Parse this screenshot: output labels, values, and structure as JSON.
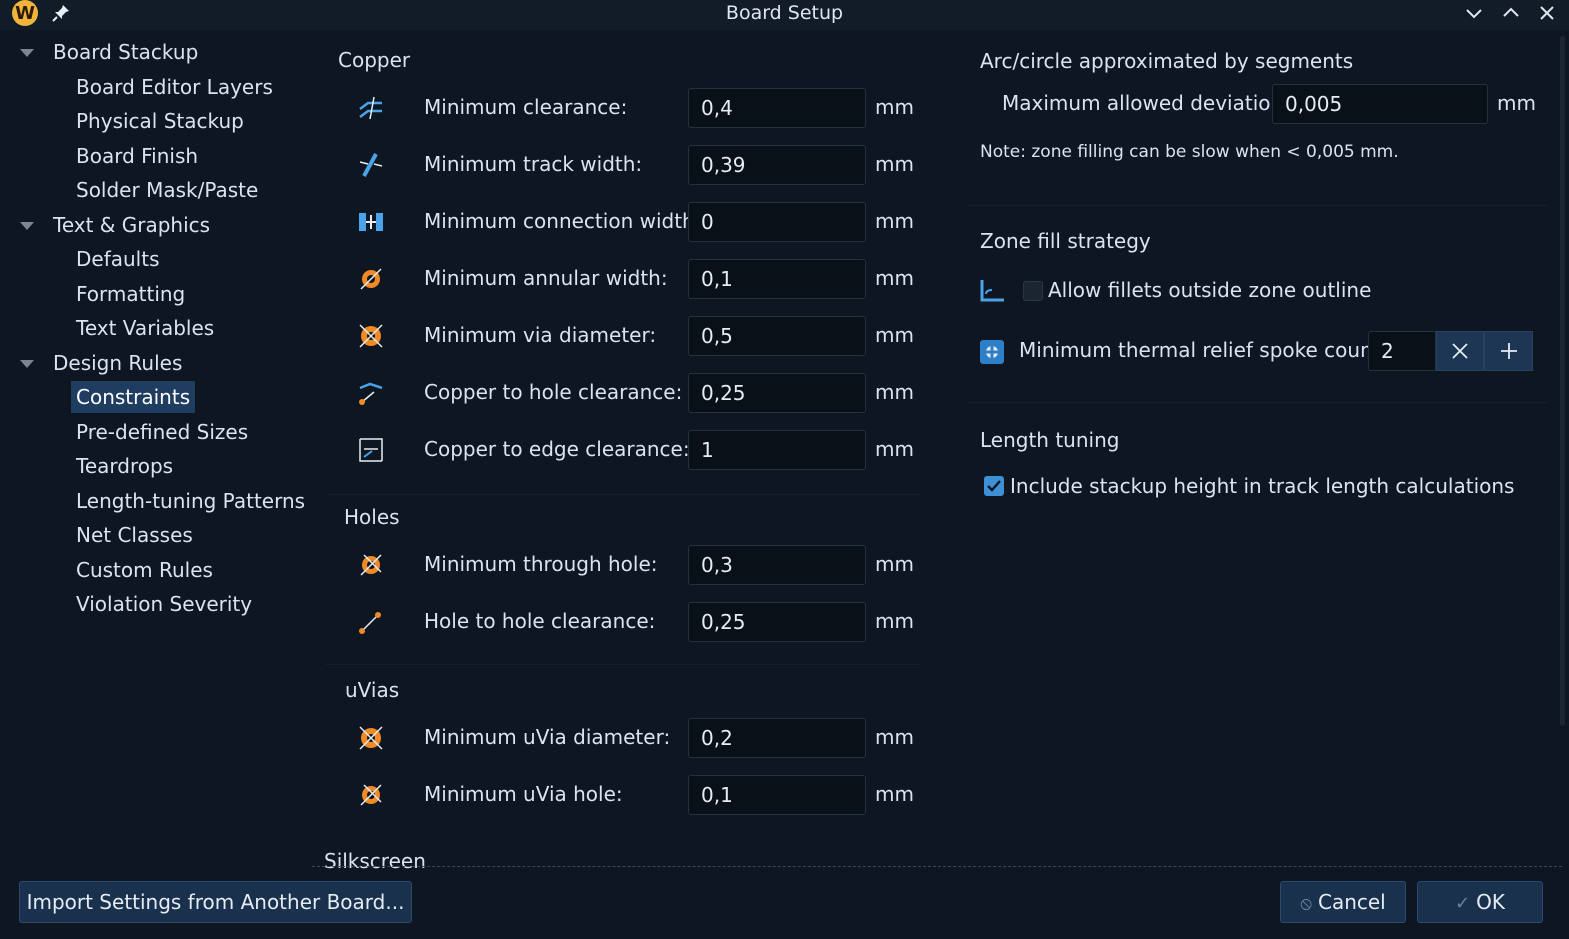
{
  "window": {
    "title": "Board Setup",
    "logo_letter": "W"
  },
  "sidebar": {
    "items": [
      {
        "label": "Board Stackup",
        "level": 0,
        "expanded": true
      },
      {
        "label": "Board Editor Layers",
        "level": 1
      },
      {
        "label": "Physical Stackup",
        "level": 1
      },
      {
        "label": "Board Finish",
        "level": 1
      },
      {
        "label": "Solder Mask/Paste",
        "level": 1
      },
      {
        "label": "Text & Graphics",
        "level": 0,
        "expanded": true
      },
      {
        "label": "Defaults",
        "level": 1
      },
      {
        "label": "Formatting",
        "level": 1
      },
      {
        "label": "Text Variables",
        "level": 1
      },
      {
        "label": "Design Rules",
        "level": 0,
        "expanded": true
      },
      {
        "label": "Constraints",
        "level": 1,
        "selected": true
      },
      {
        "label": "Pre-defined Sizes",
        "level": 1
      },
      {
        "label": "Teardrops",
        "level": 1
      },
      {
        "label": "Length-tuning Patterns",
        "level": 1
      },
      {
        "label": "Net Classes",
        "level": 1
      },
      {
        "label": "Custom Rules",
        "level": 1
      },
      {
        "label": "Violation Severity",
        "level": 1
      }
    ]
  },
  "constraints": {
    "copper": {
      "title": "Copper",
      "fields": [
        {
          "label": "Minimum clearance:",
          "value": "0,4",
          "unit": "mm",
          "icon": "clearance-icon"
        },
        {
          "label": "Minimum track width:",
          "value": "0,39",
          "unit": "mm",
          "icon": "track-width-icon"
        },
        {
          "label": "Minimum connection width:",
          "value": "0",
          "unit": "mm",
          "icon": "connection-width-icon"
        },
        {
          "label": "Minimum annular width:",
          "value": "0,1",
          "unit": "mm",
          "icon": "annular-width-icon"
        },
        {
          "label": "Minimum via diameter:",
          "value": "0,5",
          "unit": "mm",
          "icon": "via-diameter-icon"
        },
        {
          "label": "Copper to hole clearance:",
          "value": "0,25",
          "unit": "mm",
          "icon": "copper-hole-clearance-icon"
        },
        {
          "label": "Copper to edge clearance:",
          "value": "1",
          "unit": "mm",
          "icon": "edge-clearance-icon"
        }
      ]
    },
    "holes": {
      "title": "Holes",
      "fields": [
        {
          "label": "Minimum through hole:",
          "value": "0,3",
          "unit": "mm",
          "icon": "through-hole-icon"
        },
        {
          "label": "Hole to hole clearance:",
          "value": "0,25",
          "unit": "mm",
          "icon": "hole-to-hole-icon"
        }
      ]
    },
    "uvias": {
      "title": "uVias",
      "fields": [
        {
          "label": "Minimum uVia diameter:",
          "value": "0,2",
          "unit": "mm",
          "icon": "uvia-diameter-icon"
        },
        {
          "label": "Minimum uVia hole:",
          "value": "0,1",
          "unit": "mm",
          "icon": "uvia-hole-icon"
        }
      ]
    },
    "silkscreen": {
      "title": "Silkscreen"
    }
  },
  "arc": {
    "title": "Arc/circle approximated by segments",
    "deviation_label": "Maximum allowed deviation:",
    "deviation_value": "0,005",
    "deviation_unit": "mm",
    "note": "Note: zone filling can be slow when < 0,005 mm."
  },
  "zone": {
    "title": "Zone fill strategy",
    "fillets_label": "Allow fillets outside zone outline",
    "fillets_checked": false,
    "spoke_label": "Minimum thermal relief spoke count:",
    "spoke_value": "2"
  },
  "length_tuning": {
    "title": "Length tuning",
    "stackup_label": "Include stackup height in track length calculations",
    "stackup_checked": true
  },
  "buttons": {
    "import": "Import Settings from Another Board...",
    "cancel": "Cancel",
    "ok": "OK"
  },
  "colors": {
    "background": "#0d1621",
    "accent": "#3d8fd6",
    "selection": "#1f3d60",
    "icon_orange": "#f08a24"
  }
}
